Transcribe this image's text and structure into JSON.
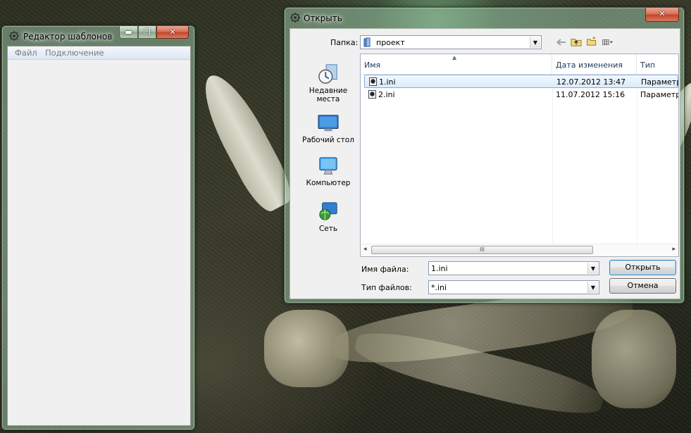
{
  "left_window": {
    "title": "Редактор шаблонов",
    "buttons": {
      "minimize": "▬",
      "maximize": "❐",
      "close": "✕"
    },
    "menu": [
      "Файл",
      "Подключение"
    ]
  },
  "dialog": {
    "title": "Открыть",
    "close_label": "✕",
    "folder_label": "Папка:",
    "folder_value": "проект",
    "places": [
      {
        "label": "Недавние места",
        "icon": "recent-places-icon"
      },
      {
        "label": "Рабочий стол",
        "icon": "desktop-icon"
      },
      {
        "label": "Компьютер",
        "icon": "computer-icon"
      },
      {
        "label": "Сеть",
        "icon": "network-icon"
      }
    ],
    "toolbar_icons": [
      "back-arrow-icon",
      "up-folder-icon",
      "new-folder-icon",
      "view-menu-icon"
    ],
    "columns": [
      "Имя",
      "Дата изменения",
      "Тип"
    ],
    "files": [
      {
        "name": "1.ini",
        "date": "12.07.2012 13:47",
        "type": "Параметр",
        "selected": true
      },
      {
        "name": "2.ini",
        "date": "11.07.2012 15:16",
        "type": "Параметр",
        "selected": false
      }
    ],
    "scroll_grip": "III",
    "filename_label": "Имя файла:",
    "filename_value": "1.ini",
    "filetype_label": "Тип файлов:",
    "filetype_value": "*.ini",
    "open_button": "Открыть",
    "cancel_button": "Отмена"
  },
  "colors": {
    "selection": "#d9ebfc",
    "selection_border": "#84acdd",
    "glass": "#96bea0"
  }
}
